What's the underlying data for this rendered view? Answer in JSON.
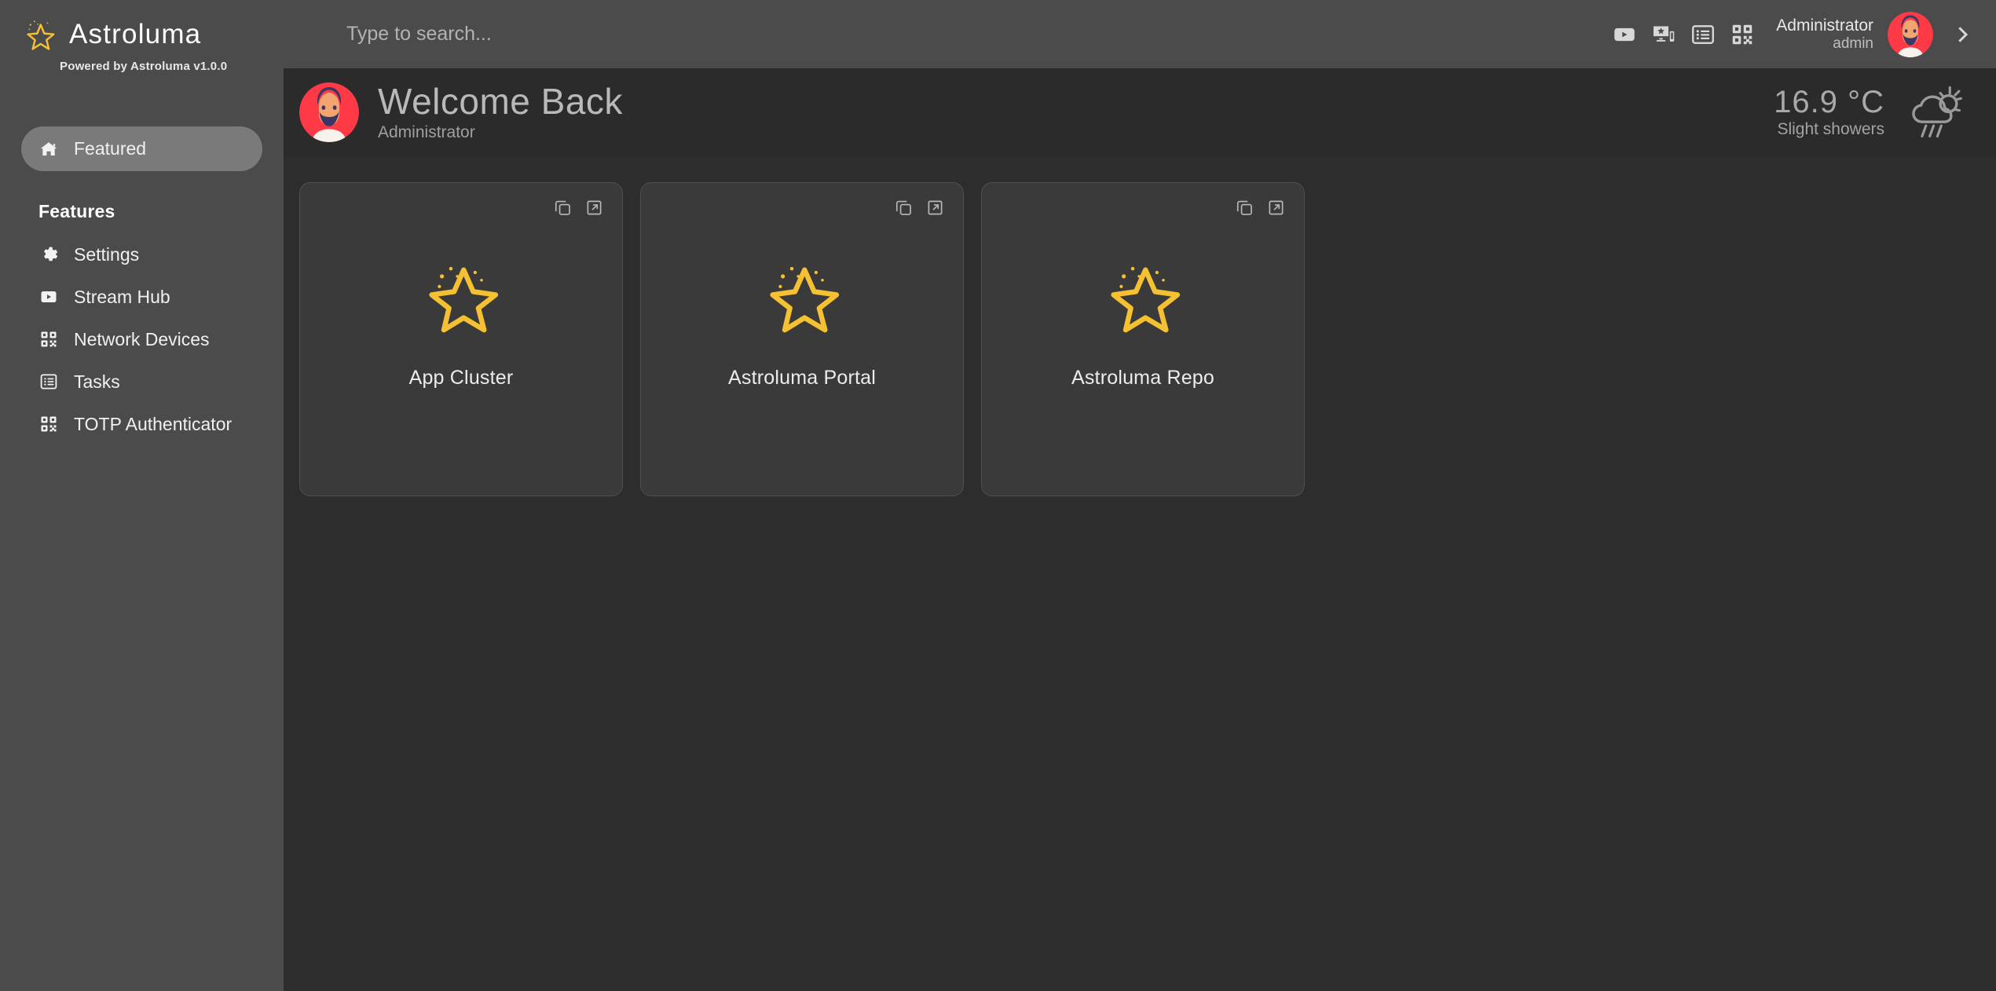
{
  "brand": {
    "name": "Astroluma",
    "tagline": "Powered by Astroluma v1.0.0",
    "logo_icon": "sparkle-star-icon",
    "accent_color": "#F5C032"
  },
  "sidebar": {
    "primary": [
      {
        "label": "Featured",
        "icon": "home-icon",
        "active": true
      }
    ],
    "section_title": "Features",
    "items": [
      {
        "label": "Settings",
        "icon": "gear-icon"
      },
      {
        "label": "Stream Hub",
        "icon": "play-box-icon"
      },
      {
        "label": "Network Devices",
        "icon": "qr-code-icon"
      },
      {
        "label": "Tasks",
        "icon": "list-box-icon"
      },
      {
        "label": "TOTP Authenticator",
        "icon": "qr-code-icon"
      }
    ]
  },
  "header": {
    "search": {
      "placeholder": "Type to search...",
      "value": "",
      "icon": "search-input"
    },
    "icons": [
      {
        "name": "play-video-icon"
      },
      {
        "name": "screen-cast-star-icon"
      },
      {
        "name": "list-view-icon"
      },
      {
        "name": "qr-code-icon"
      }
    ],
    "user": {
      "name": "Administrator",
      "role": "admin",
      "avatar_icon": "bearded-man-avatar",
      "avatar_bg": "#FF3A46"
    },
    "expand_icon": "chevron-right-icon"
  },
  "welcome": {
    "avatar_icon": "bearded-man-avatar",
    "title": "Welcome Back",
    "subtitle": "Administrator",
    "weather": {
      "temperature": "16.9 °C",
      "description": "Slight showers",
      "icon": "sun-cloud-rain-icon"
    }
  },
  "main": {
    "cards": [
      {
        "title": "App Cluster",
        "logo_icon": "sparkle-star-icon",
        "copy_icon": "copy-icon",
        "open_icon": "external-link-icon"
      },
      {
        "title": "Astroluma Portal",
        "logo_icon": "sparkle-star-icon",
        "copy_icon": "copy-icon",
        "open_icon": "external-link-icon"
      },
      {
        "title": "Astroluma Repo",
        "logo_icon": "sparkle-star-icon",
        "copy_icon": "copy-icon",
        "open_icon": "external-link-icon"
      }
    ]
  },
  "colors": {
    "sidebar_bg": "#4B4B4B",
    "content_bg": "#2D2D2D",
    "banner_bg": "#2B2B2B",
    "card_bg": "#3A3A3A",
    "active_nav_bg": "#7A7A7A",
    "star_yellow": "#F5C032"
  }
}
